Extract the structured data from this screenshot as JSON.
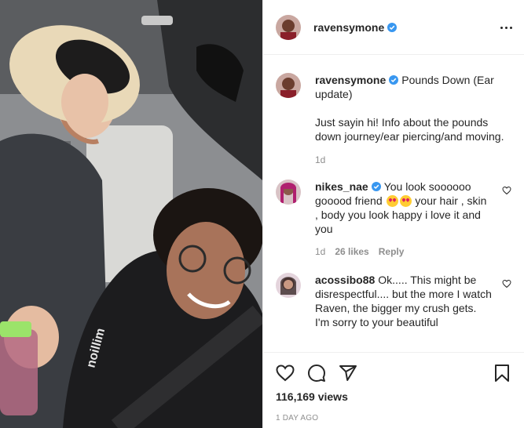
{
  "post": {
    "username": "ravensymone",
    "verified": true,
    "caption_title": "Pounds Down (Ear update)",
    "caption_body": "Just sayin hi! Info about the pounds down journey/ear piercing/and moving.",
    "caption_time": "1d"
  },
  "comments": [
    {
      "username": "nikes_nae",
      "verified": true,
      "text_part1": "You look soooooo gooood friend",
      "text_part2": "your hair , skin , body you look happy i love it and you",
      "time": "1d",
      "likes": "26 likes",
      "reply_label": "Reply"
    },
    {
      "username": "acossibo88",
      "verified": false,
      "text": "Ok..... This might be disrespectful.... but the more I watch Raven, the bigger my crush gets. I'm sorry to your beautiful"
    }
  ],
  "stats": {
    "views": "116,169 views",
    "date": "1 DAY AGO"
  },
  "icons": {
    "more": "more-options-icon",
    "verified": "verified-badge-icon",
    "like": "heart-icon",
    "comment": "comment-icon",
    "share": "share-icon",
    "save": "bookmark-icon"
  },
  "colors": {
    "verified_blue": "#3897f0",
    "text": "#262626",
    "secondary": "#8e8e8e",
    "border": "#efefef"
  }
}
